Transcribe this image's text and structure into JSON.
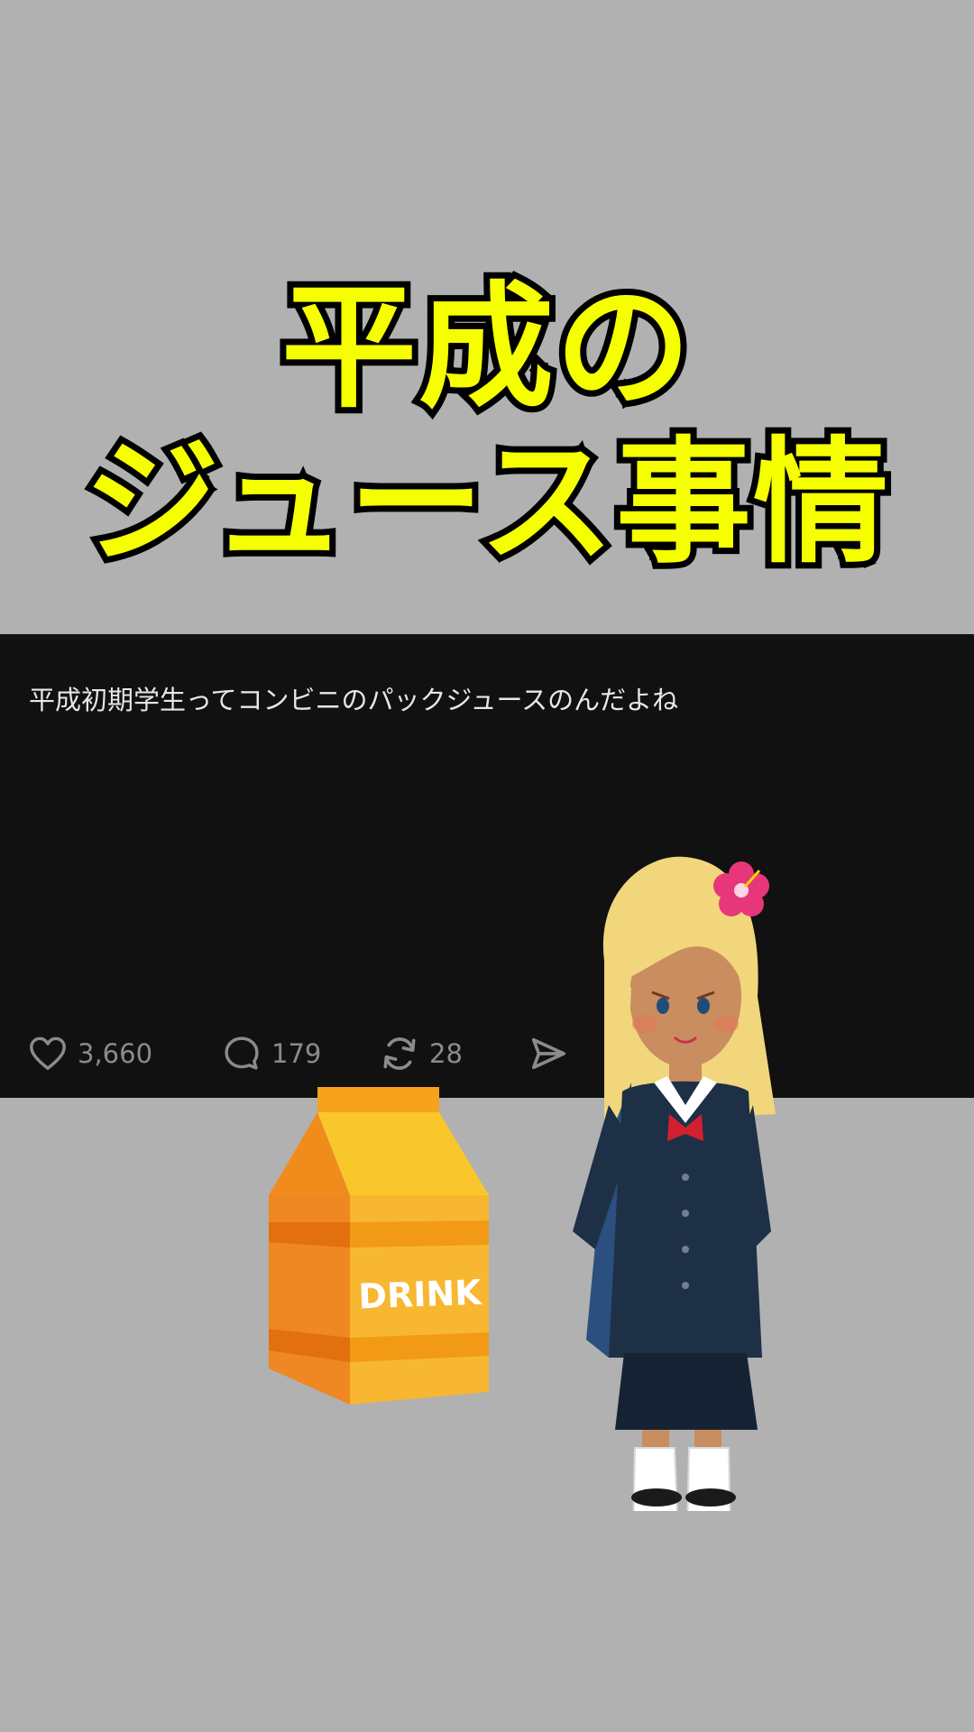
{
  "title": {
    "line1": "平成の",
    "line2": "ジュース事情"
  },
  "post": {
    "text": "平成初期学生ってコンビニのパックジュースのんだよね",
    "likes": "3,660",
    "replies": "179",
    "reposts": "28",
    "icons": [
      "heart-icon",
      "reply-bubble-icon",
      "repost-icon",
      "share-send-icon"
    ]
  },
  "illustration": {
    "carton_label": "DRINK"
  },
  "colors": {
    "background": "#b1b1b1",
    "title_fill": "#f6ff00",
    "title_stroke": "#000000",
    "post_background": "#111111",
    "post_text": "#e7e7e7",
    "action_gray": "#8b8b8b"
  }
}
